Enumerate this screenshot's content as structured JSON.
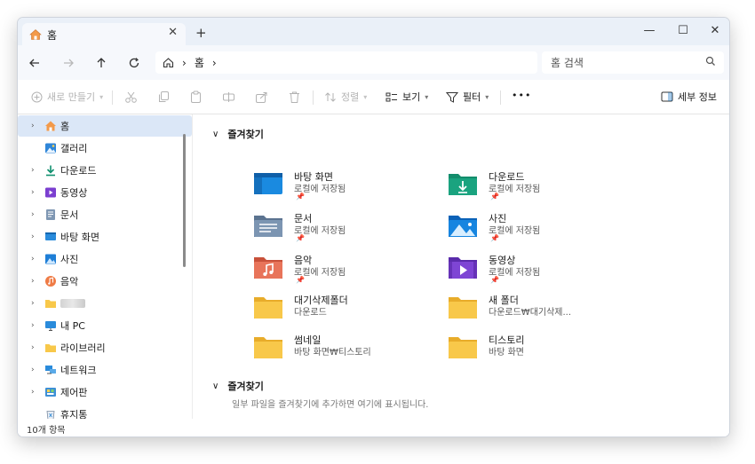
{
  "tab": {
    "title": "홈",
    "close": "✕",
    "new_tab": "+"
  },
  "window_controls": {
    "minimize": "—",
    "maximize": "☐",
    "close": "✕"
  },
  "address": {
    "home_glyph": "⌂",
    "sep1": "›",
    "crumb": "홈",
    "sep2": "›"
  },
  "search": {
    "placeholder": "홈 검색"
  },
  "commands": {
    "new": "새로 만들기",
    "sort": "정렬",
    "view": "보기",
    "filter": "필터",
    "more": "•••",
    "details": "세부 정보"
  },
  "sidebar": {
    "items": [
      {
        "label": "홈"
      },
      {
        "label": "갤러리"
      },
      {
        "label": "다운로드"
      },
      {
        "label": "동영상"
      },
      {
        "label": "문서"
      },
      {
        "label": "바탕 화면"
      },
      {
        "label": "사진"
      },
      {
        "label": "음악"
      },
      {
        "label": ""
      },
      {
        "label": "내 PC"
      },
      {
        "label": "라이브러리"
      },
      {
        "label": "네트워크"
      },
      {
        "label": "제어판"
      },
      {
        "label": "휴지통"
      }
    ]
  },
  "main": {
    "favorites_title": "즐겨찾기",
    "tiles": [
      {
        "name": "바탕 화면",
        "sub": "로컬에 저장됨",
        "pin": "📌"
      },
      {
        "name": "다운로드",
        "sub": "로컬에 저장됨",
        "pin": "📌"
      },
      {
        "name": "문서",
        "sub": "로컬에 저장됨",
        "pin": "📌"
      },
      {
        "name": "사진",
        "sub": "로컬에 저장됨",
        "pin": "📌"
      },
      {
        "name": "음악",
        "sub": "로컬에 저장됨",
        "pin": "📌"
      },
      {
        "name": "동영상",
        "sub": "로컬에 저장됨",
        "pin": "📌"
      },
      {
        "name": "대기삭제폴더",
        "sub": "다운로드",
        "pin": ""
      },
      {
        "name": "새 폴더",
        "sub": "다운로드₩대기삭제...",
        "pin": ""
      },
      {
        "name": "썸네일",
        "sub": "바탕 화면₩티스토리",
        "pin": ""
      },
      {
        "name": "티스토리",
        "sub": "바탕 화면",
        "pin": ""
      }
    ],
    "second_title": "즐겨찾기",
    "empty_message": "일부 파일을 즐겨찾기에 추가하면 여기에 표시됩니다."
  },
  "status": {
    "count": "10개 항목"
  },
  "colors": {
    "accent": "#0067c0",
    "folder": "#f8c84a",
    "selection": "#dbe7f7"
  }
}
